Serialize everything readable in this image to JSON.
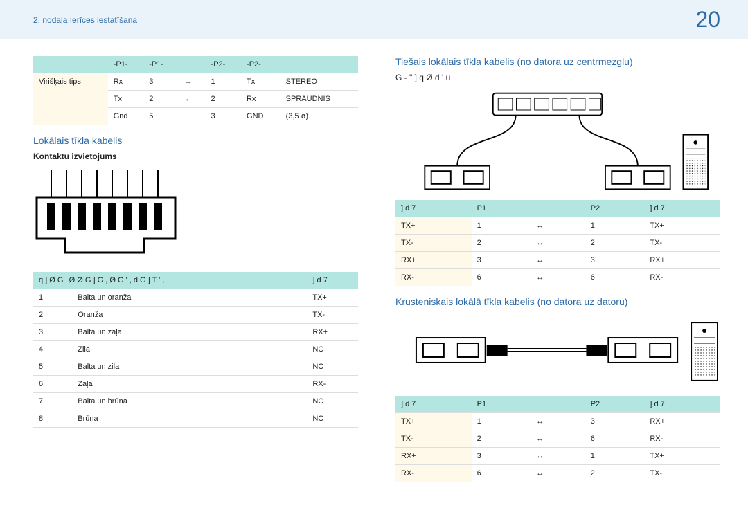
{
  "header": {
    "breadcrumb": "2. nodaļa Ierīces iestatīšana",
    "page_number": "20"
  },
  "left": {
    "top_table": {
      "headers": [
        "-P1-",
        "-P1-",
        "",
        "-P2-",
        "-P2-",
        ""
      ],
      "side_label": "Virišķais tips",
      "rows": [
        [
          "Rx",
          "3",
          "→",
          "1",
          "Tx",
          "STEREO"
        ],
        [
          "Tx",
          "2",
          "←",
          "2",
          "Rx",
          "SPRAUDNIS"
        ],
        [
          "Gnd",
          "5",
          "",
          "3",
          "GND",
          "(3,5 ø)"
        ]
      ]
    },
    "section_title": "Lokālais tīkla kabelis",
    "sub_title": "Kontaktu izvietojums",
    "pin_table": {
      "h1": "q ] Ø G ' Ø Ø G ]   G , Ø G   ' , d   G ] T ' ,",
      "h2": "] d 7",
      "rows": [
        [
          "1",
          "Balta un oranža",
          "TX+"
        ],
        [
          "2",
          "Oranža",
          "TX-"
        ],
        [
          "3",
          "Balta un zaļa",
          "RX+"
        ],
        [
          "4",
          "Zila",
          "NC"
        ],
        [
          "5",
          "Balta un zila",
          "NC"
        ],
        [
          "6",
          "Zaļa",
          "RX-"
        ],
        [
          "7",
          "Balta un brūna",
          "NC"
        ],
        [
          "8",
          "Brūna",
          "NC"
        ]
      ]
    }
  },
  "right": {
    "section1_title": "Tiešais lokālais tīkla kabelis (no datora uz centrmezglu)",
    "section1_note": "G -   \" ] q Ø d     '   u",
    "lan_table1": {
      "headers": [
        "] d 7",
        "P1",
        "",
        "P2",
        "] d 7"
      ],
      "rows": [
        [
          "TX+",
          "1",
          "↔",
          "1",
          "TX+"
        ],
        [
          "TX-",
          "2",
          "↔",
          "2",
          "TX-"
        ],
        [
          "RX+",
          "3",
          "↔",
          "3",
          "RX+"
        ],
        [
          "RX-",
          "6",
          "↔",
          "6",
          "RX-"
        ]
      ]
    },
    "section2_title": "Krusteniskais lokālā tīkla kabelis (no datora uz datoru)",
    "lan_table2": {
      "headers": [
        "] d 7",
        "P1",
        "",
        "P2",
        "] d 7"
      ],
      "rows": [
        [
          "TX+",
          "1",
          "↔",
          "3",
          "RX+"
        ],
        [
          "TX-",
          "2",
          "↔",
          "6",
          "RX-"
        ],
        [
          "RX+",
          "3",
          "↔",
          "1",
          "TX+"
        ],
        [
          "RX-",
          "6",
          "↔",
          "2",
          "TX-"
        ]
      ]
    }
  }
}
